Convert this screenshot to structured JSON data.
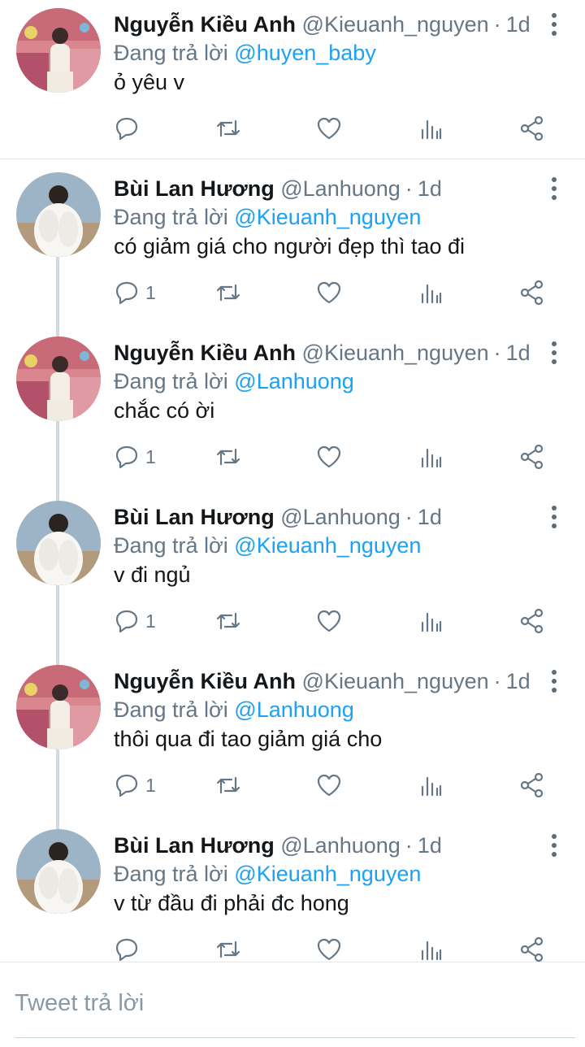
{
  "thread": {
    "tweets": [
      {
        "author_name": "Nguyễn Kiều Anh",
        "handle": "@Kieuanh_nguyen",
        "separator": "·",
        "time": "1d",
        "replying_label": "Đang trả lời",
        "replying_to": "@huyen_baby",
        "text": "ỏ yêu v",
        "reply_count": "",
        "avatar": "kieu-anh-avatar"
      },
      {
        "author_name": "Bùi Lan Hương",
        "handle": "@Lanhuong",
        "separator": "·",
        "time": "1d",
        "replying_label": "Đang trả lời",
        "replying_to": "@Kieuanh_nguyen",
        "text": "có giảm giá cho người đẹp thì tao đi",
        "reply_count": "1",
        "avatar": "lan-huong-avatar"
      },
      {
        "author_name": "Nguyễn Kiều Anh",
        "handle": "@Kieuanh_nguyen",
        "separator": "·",
        "time": "1d",
        "replying_label": "Đang trả lời",
        "replying_to": "@Lanhuong",
        "text": "chắc có ời",
        "reply_count": "1",
        "avatar": "kieu-anh-avatar"
      },
      {
        "author_name": "Bùi Lan Hương",
        "handle": "@Lanhuong",
        "separator": "·",
        "time": "1d",
        "replying_label": "Đang trả lời",
        "replying_to": "@Kieuanh_nguyen",
        "text": "v đi ngủ",
        "reply_count": "1",
        "avatar": "lan-huong-avatar"
      },
      {
        "author_name": "Nguyễn Kiều Anh",
        "handle": "@Kieuanh_nguyen",
        "separator": "·",
        "time": "1d",
        "replying_label": "Đang trả lời",
        "replying_to": "@Lanhuong",
        "text": "thôi qua đi tao giảm giá cho",
        "reply_count": "1",
        "avatar": "kieu-anh-avatar"
      },
      {
        "author_name": "Bùi Lan Hương",
        "handle": "@Lanhuong",
        "separator": "·",
        "time": "1d",
        "replying_label": "Đang trả lời",
        "replying_to": "@Kieuanh_nguyen",
        "text": "v từ đầu đi phải đc hong",
        "reply_count": "",
        "avatar": "lan-huong-avatar"
      }
    ]
  },
  "composer": {
    "placeholder": "Tweet trả lời"
  },
  "colors": {
    "link": "#1da1f2",
    "secondary_text": "#657786",
    "primary_text": "#14171a",
    "divider": "#e1e8ed"
  },
  "icons": [
    "reply-icon",
    "retweet-icon",
    "like-icon",
    "stats-icon",
    "share-icon",
    "more-options-icon"
  ]
}
